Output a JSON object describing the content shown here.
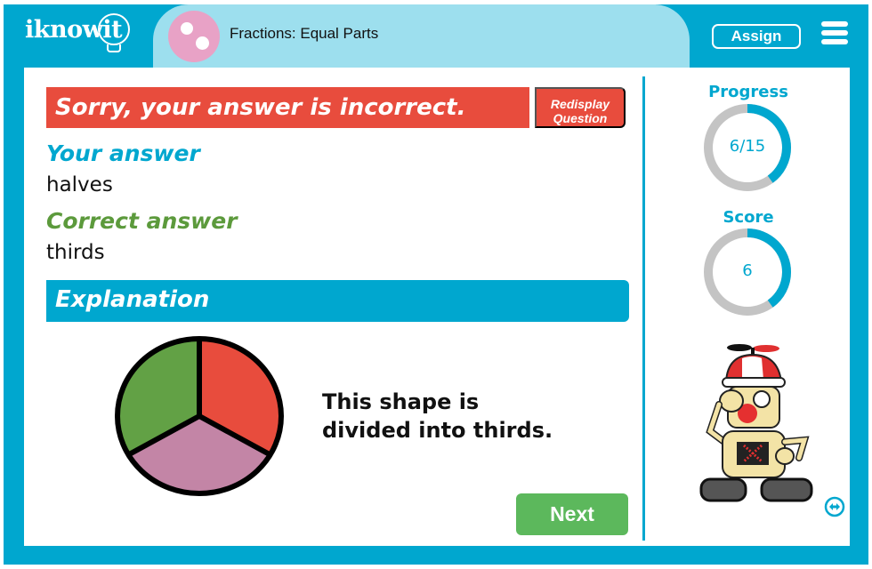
{
  "header": {
    "logo_text": "iknowit",
    "topic_title": "Fractions: Equal Parts",
    "assign_label": "Assign",
    "menu_icon": "hamburger-menu-icon",
    "topic_icon": "fraction-dots-icon"
  },
  "feedback": {
    "banner_text": "Sorry, your answer is incorrect.",
    "redisplay_line1": "Redisplay",
    "redisplay_line2": "Question",
    "your_answer_label": "Your answer",
    "your_answer_value": "halves",
    "correct_answer_label": "Correct answer",
    "correct_answer_value": "thirds"
  },
  "explanation": {
    "heading": "Explanation",
    "text_line1": "This shape is",
    "text_line2": "divided into thirds.",
    "shape": {
      "type": "circle",
      "parts": 3,
      "colors": [
        "#e84c3d",
        "#c385a6",
        "#62a145"
      ]
    }
  },
  "actions": {
    "next_label": "Next"
  },
  "sidebar": {
    "progress_label": "Progress",
    "progress_text": "6/15",
    "progress_current": 6,
    "progress_total": 15,
    "score_label": "Score",
    "score_text": "6",
    "score_fraction": 0.4,
    "mascot": "robot-mascot",
    "toggle_icon": "swap-arrows-icon"
  },
  "colors": {
    "brand_blue": "#00a7cf",
    "light_blue": "#9ddfee",
    "error_red": "#e84c3d",
    "success_green": "#5cb85c",
    "correct_green": "#5c9a3c",
    "ring_gray": "#c4c4c4"
  }
}
